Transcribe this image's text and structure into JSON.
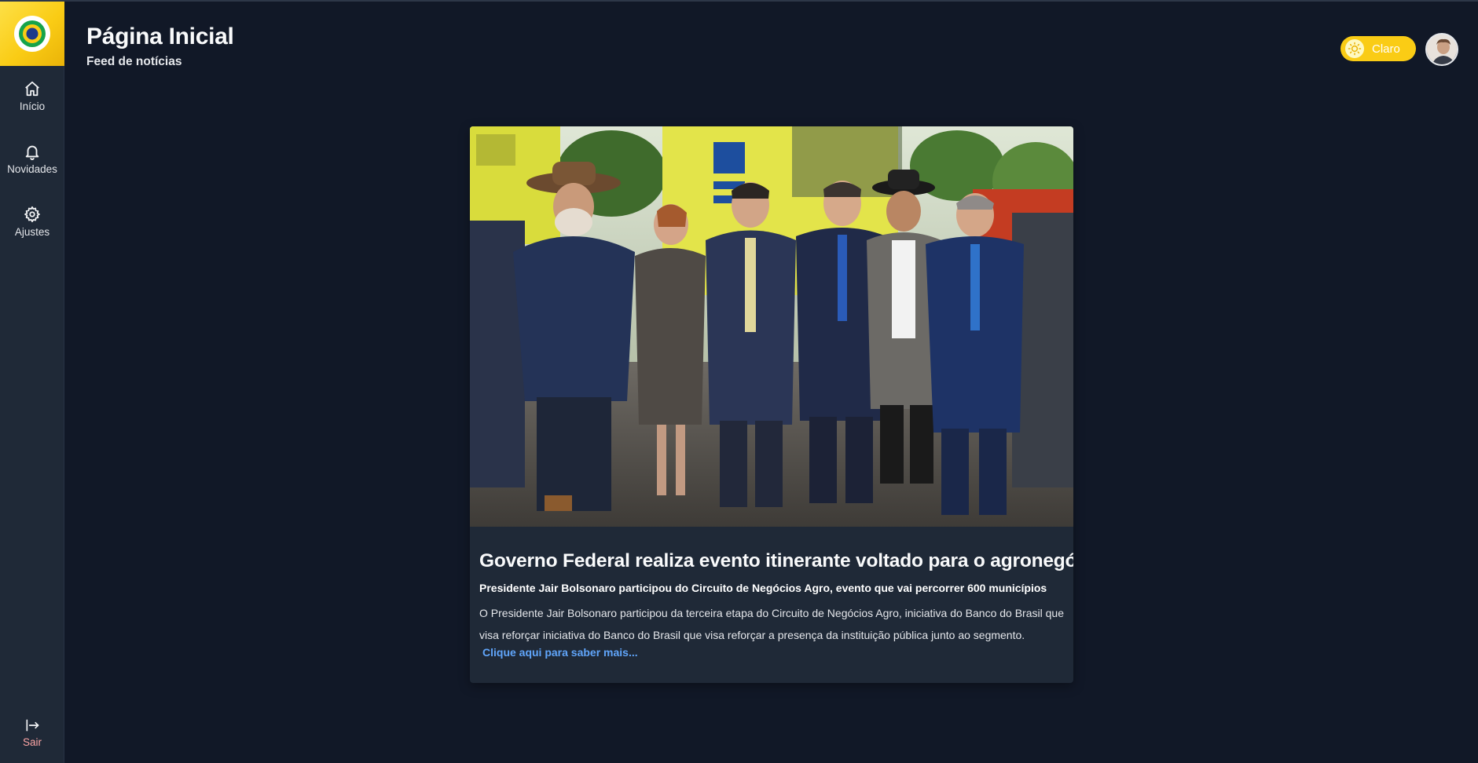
{
  "sidebar": {
    "logo_icon": "brazil-flag-circle-icon",
    "items": [
      {
        "label": "Início",
        "icon": "home-icon"
      },
      {
        "label": "Novidades",
        "icon": "bell-icon"
      },
      {
        "label": "Ajustes",
        "icon": "gear-icon"
      }
    ],
    "logout": {
      "label": "Sair",
      "icon": "logout-icon"
    }
  },
  "header": {
    "title": "Página Inicial",
    "subtitle": "Feed de notícias",
    "theme_toggle": {
      "label": "Claro",
      "icon": "sun-icon"
    },
    "avatar_icon": "user-avatar"
  },
  "news": {
    "image": "group-photo-event",
    "title": "Governo Federal realiza evento itinerante voltado para o agronegócio",
    "subtitle": "Presidente Jair Bolsonaro participou do Circuito de Negócios Agro, evento que vai percorrer 600 municípios",
    "body": "O Presidente Jair Bolsonaro participou da terceira etapa do Circuito de Negócios Agro, iniciativa do Banco do Brasil que visa reforçar iniciativa do Banco do Brasil que visa reforçar a presença da instituição pública junto ao segmento.",
    "link_label": "Clique aqui para saber mais..."
  },
  "colors": {
    "background": "#111827",
    "sidebar": "#1f2937",
    "accent_yellow": "#facc15",
    "link": "#60a5fa"
  }
}
